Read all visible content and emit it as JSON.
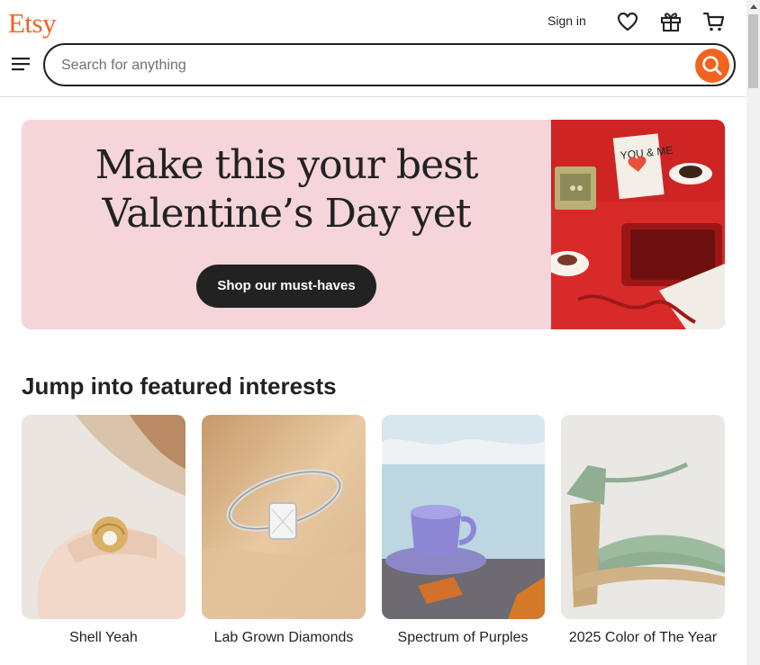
{
  "header": {
    "logo": "Etsy",
    "sign_in": "Sign in",
    "search_placeholder": "Search for anything",
    "icons": [
      "menu-icon",
      "heart-icon",
      "gift-icon",
      "cart-icon",
      "search-icon"
    ]
  },
  "hero": {
    "title_line1": "Make this your best",
    "title_line2": "Valentine’s Day yet",
    "button_label": "Shop our must-haves",
    "card_text": "YOU & ME",
    "background_color": "#f5d5da"
  },
  "featured": {
    "title": "Jump into featured interests",
    "items": [
      {
        "label": "Shell Yeah"
      },
      {
        "label": "Lab Grown Diamonds"
      },
      {
        "label": "Spectrum of Purples"
      },
      {
        "label": "2025 Color of The Year"
      }
    ]
  },
  "colors": {
    "brand": "#f1641e",
    "dark": "#222222"
  }
}
